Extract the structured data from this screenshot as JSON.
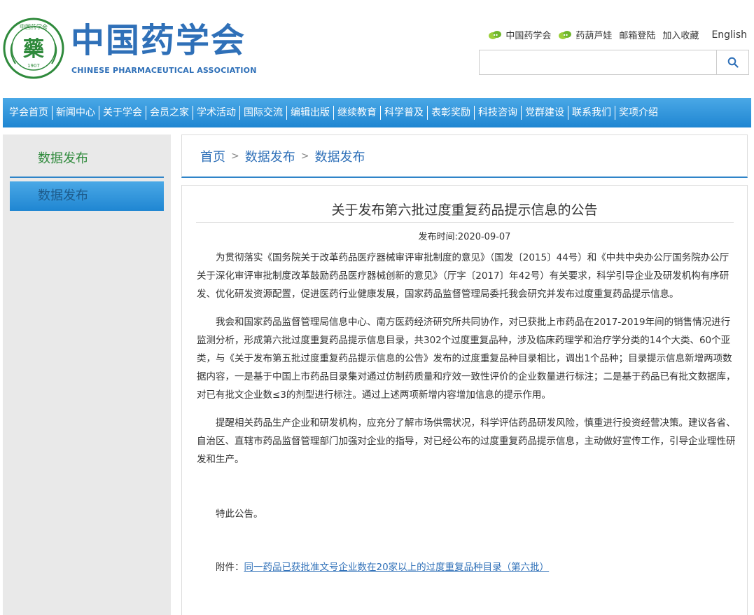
{
  "header": {
    "logo_cn": "中国药学会",
    "logo_en": "CHINESE PHARMACEUTICAL ASSOCIATION",
    "emblem_top_text": "中国药学会",
    "emblem_center": "藥",
    "emblem_year": "1907",
    "emblem_ring_text": "CHINESE PHARMACEUTICAL ASSOCIATION",
    "emblem_color": "#2f8a3c",
    "brand_color": "#2f70b8"
  },
  "toplinks": {
    "cpa": "中国药学会",
    "mascot": "药葫芦娃",
    "mail": "邮箱登陆",
    "favorite": "加入收藏",
    "english": "English"
  },
  "search": {
    "placeholder": "",
    "icon": "search-icon"
  },
  "nav": {
    "items": [
      "学会首页",
      "新闻中心",
      "关于学会",
      "会员之家",
      "学术活动",
      "国际交流",
      "编辑出版",
      "继续教育",
      "科学普及",
      "表彰奖励",
      "科技咨询",
      "党群建设",
      "联系我们",
      "奖项介绍"
    ],
    "color": "#2288d4"
  },
  "sidebar": {
    "title": "数据发布",
    "active_item": "数据发布"
  },
  "breadcrumb": {
    "home": "首页",
    "level1": "数据发布",
    "level2": "数据发布",
    "sep": ">"
  },
  "article": {
    "title": "关于发布第六批过度重复药品提示信息的公告",
    "date_label": "发布时间:",
    "date": "2020-09-07",
    "paragraphs": [
      "为贯彻落实《国务院关于改革药品医疗器械审评审批制度的意见》（国发〔2015〕44号）和《中共中央办公厅国务院办公厅关于深化审评审批制度改革鼓励药品医疗器械创新的意见》（厅字〔2017〕年42号）有关要求，科学引导企业及研发机构有序研发、优化研发资源配置，促进医药行业健康发展，国家药品监督管理局委托我会研究并发布过度重复药品提示信息。",
      "我会和国家药品监督管理局信息中心、南方医药经济研究所共同协作，对已获批上市药品在2017-2019年间的销售情况进行监测分析，形成第六批过度重复药品提示信息目录，共302个过度重复品种，涉及临床药理学和治疗学分类的14个大类、60个亚类，与《关于发布第五批过度重复药品提示信息的公告》发布的过度重复品种目录相比，调出1个品种；目录提示信息新增两项数据内容，一是基于中国上市药品目录集对通过仿制药质量和疗效一致性评价的企业数量进行标注；二是基于药品已有批文数据库，对已有批文企业数≤3的剂型进行标注。通过上述两项新增内容增加信息的提示作用。",
      "提醒相关药品生产企业和研发机构，应充分了解市场供需状况，科学评估药品研发风险，慎重进行投资经营决策。建议各省、自治区、直辖市药品监督管理部门加强对企业的指导，对已经公布的过度重复药品提示信息，主动做好宣传工作，引导企业理性研发和生产。"
    ],
    "sign": "特此公告。",
    "attach_label": "附件：",
    "attach_link": "同一药品已获批准文号企业数在20家以上的过度重复品种目录（第六批）"
  }
}
